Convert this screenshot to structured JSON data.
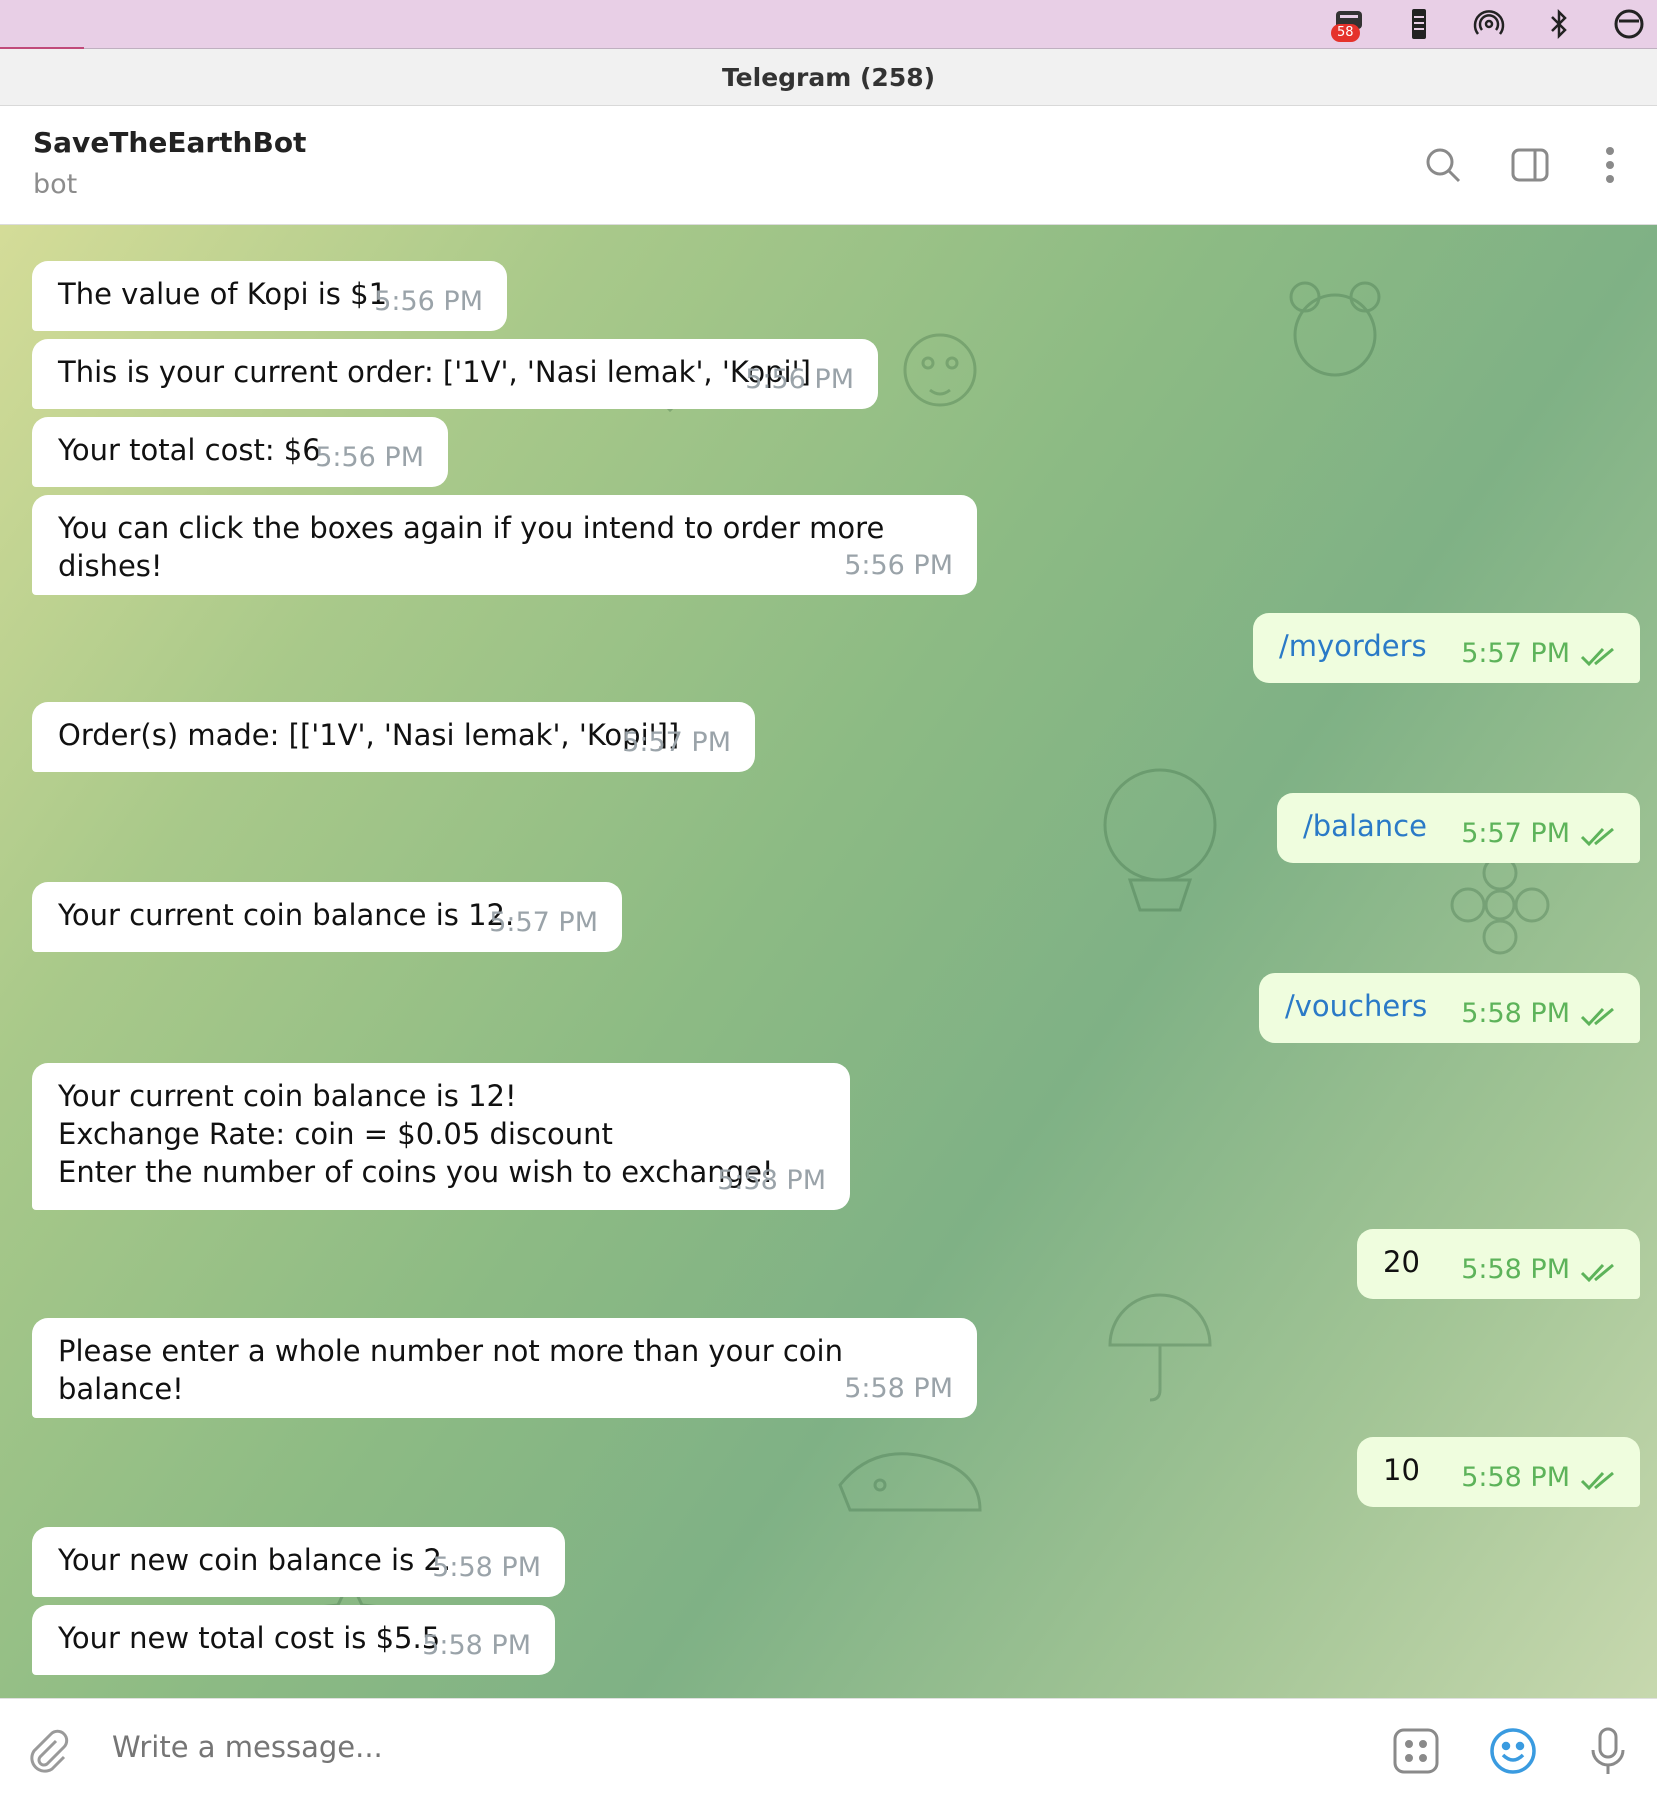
{
  "menubar": {
    "badge_count": "58"
  },
  "window": {
    "title": "Telegram (258)"
  },
  "header": {
    "name": "SaveTheEarthBot",
    "subtitle": "bot"
  },
  "messages": [
    {
      "dir": "in",
      "text": "The value of Kopi is $1",
      "time": "5:56 PM"
    },
    {
      "dir": "in",
      "text": "This is your current order: ['1V', 'Nasi lemak', 'Kopi']",
      "time": "5:56 PM"
    },
    {
      "dir": "in",
      "text": "Your total cost: $6",
      "time": "5:56 PM"
    },
    {
      "dir": "in",
      "text": "You can click the boxes again if you intend to order more dishes!",
      "time": "5:56 PM"
    },
    {
      "dir": "out",
      "text": "/myorders",
      "time": "5:57 PM"
    },
    {
      "dir": "in",
      "text": "Order(s) made: [['1V', 'Nasi lemak', 'Kopi']]",
      "time": "5:57 PM"
    },
    {
      "dir": "out",
      "text": "/balance",
      "time": "5:57 PM"
    },
    {
      "dir": "in",
      "text": "Your current coin balance is 12.",
      "time": "5:57 PM"
    },
    {
      "dir": "out",
      "text": "/vouchers",
      "time": "5:58 PM"
    },
    {
      "dir": "in",
      "text": "Your current coin balance is 12!\nExchange Rate: coin = $0.05 discount\nEnter the number of coins you wish to exchange!",
      "time": "5:58 PM"
    },
    {
      "dir": "out",
      "text": "20",
      "time": "5:58 PM"
    },
    {
      "dir": "in",
      "text": "Please enter a whole number not more than your coin balance!",
      "time": "5:58 PM"
    },
    {
      "dir": "out",
      "text": "10",
      "time": "5:58 PM"
    },
    {
      "dir": "in",
      "text": "Your new coin balance is 2.",
      "time": "5:58 PM"
    },
    {
      "dir": "in",
      "text": "Your new total cost is $5.5",
      "time": "5:58 PM"
    }
  ],
  "composer": {
    "placeholder": "Write a message..."
  },
  "colors": {
    "incoming_bubble": "#ffffff",
    "outgoing_bubble": "#effdde",
    "link": "#2a7ac7",
    "read_check": "#5db35a"
  }
}
